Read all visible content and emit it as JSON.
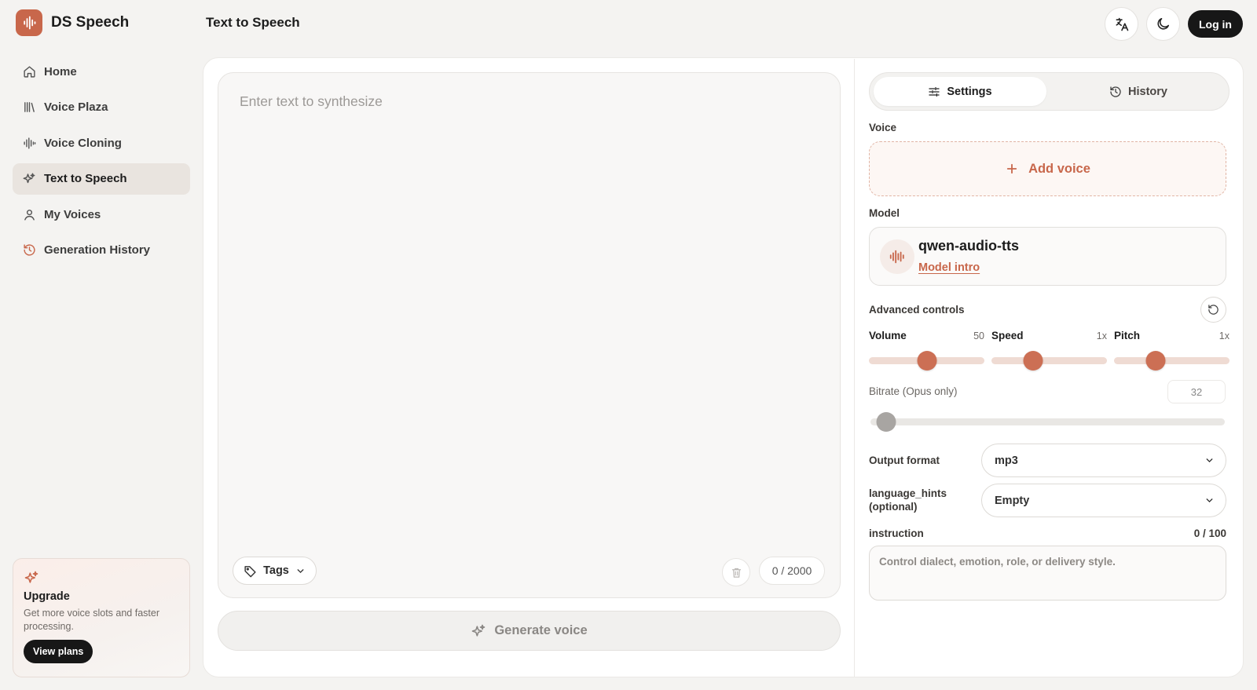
{
  "app": {
    "name": "DS Speech",
    "page_title": "Text to Speech"
  },
  "topbar": {
    "login_label": "Log in"
  },
  "sidebar": {
    "items": [
      {
        "label": "Home",
        "icon": "home-icon",
        "active": false
      },
      {
        "label": "Voice Plaza",
        "icon": "library-icon",
        "active": false
      },
      {
        "label": "Voice Cloning",
        "icon": "audio-waveform-icon",
        "active": false
      },
      {
        "label": "Text to Speech",
        "icon": "sparkles-icon",
        "active": true
      },
      {
        "label": "My Voices",
        "icon": "user-icon",
        "active": false
      },
      {
        "label": "Generation History",
        "icon": "history-icon",
        "active": false
      }
    ],
    "upgrade": {
      "title": "Upgrade",
      "text": "Get more voice slots and faster processing.",
      "button": "View plans"
    }
  },
  "editor": {
    "placeholder": "Enter text to synthesize",
    "tags_label": "Tags",
    "counter": "0 / 2000",
    "generate_label": "Generate voice"
  },
  "panel": {
    "tabs": {
      "settings": "Settings",
      "history": "History"
    },
    "voice": {
      "label": "Voice",
      "add_label": "Add voice"
    },
    "model": {
      "label": "Model",
      "name": "qwen-audio-tts",
      "link": "Model intro"
    },
    "advanced": {
      "label": "Advanced controls",
      "sliders": [
        {
          "name": "Volume",
          "display": "50",
          "fraction": 0.5
        },
        {
          "name": "Speed",
          "display": "1x",
          "fraction": 0.36
        },
        {
          "name": "Pitch",
          "display": "1x",
          "fraction": 0.36
        }
      ]
    },
    "bitrate": {
      "label": "Bitrate (Opus only)",
      "value": "32",
      "fraction": 0.03
    },
    "output_format": {
      "label": "Output format",
      "value": "mp3"
    },
    "language_hints": {
      "label_line1": "language_hints",
      "label_line2": "(optional)",
      "value": "Empty"
    },
    "instruction": {
      "label": "instruction",
      "count": "0 / 100",
      "placeholder": "Control dialect, emotion, role, or delivery style."
    }
  },
  "colors": {
    "accent": "#c8674b",
    "slider_track": "#efdbd3",
    "dark_button": "#171717",
    "background": "#f4f3f1"
  }
}
